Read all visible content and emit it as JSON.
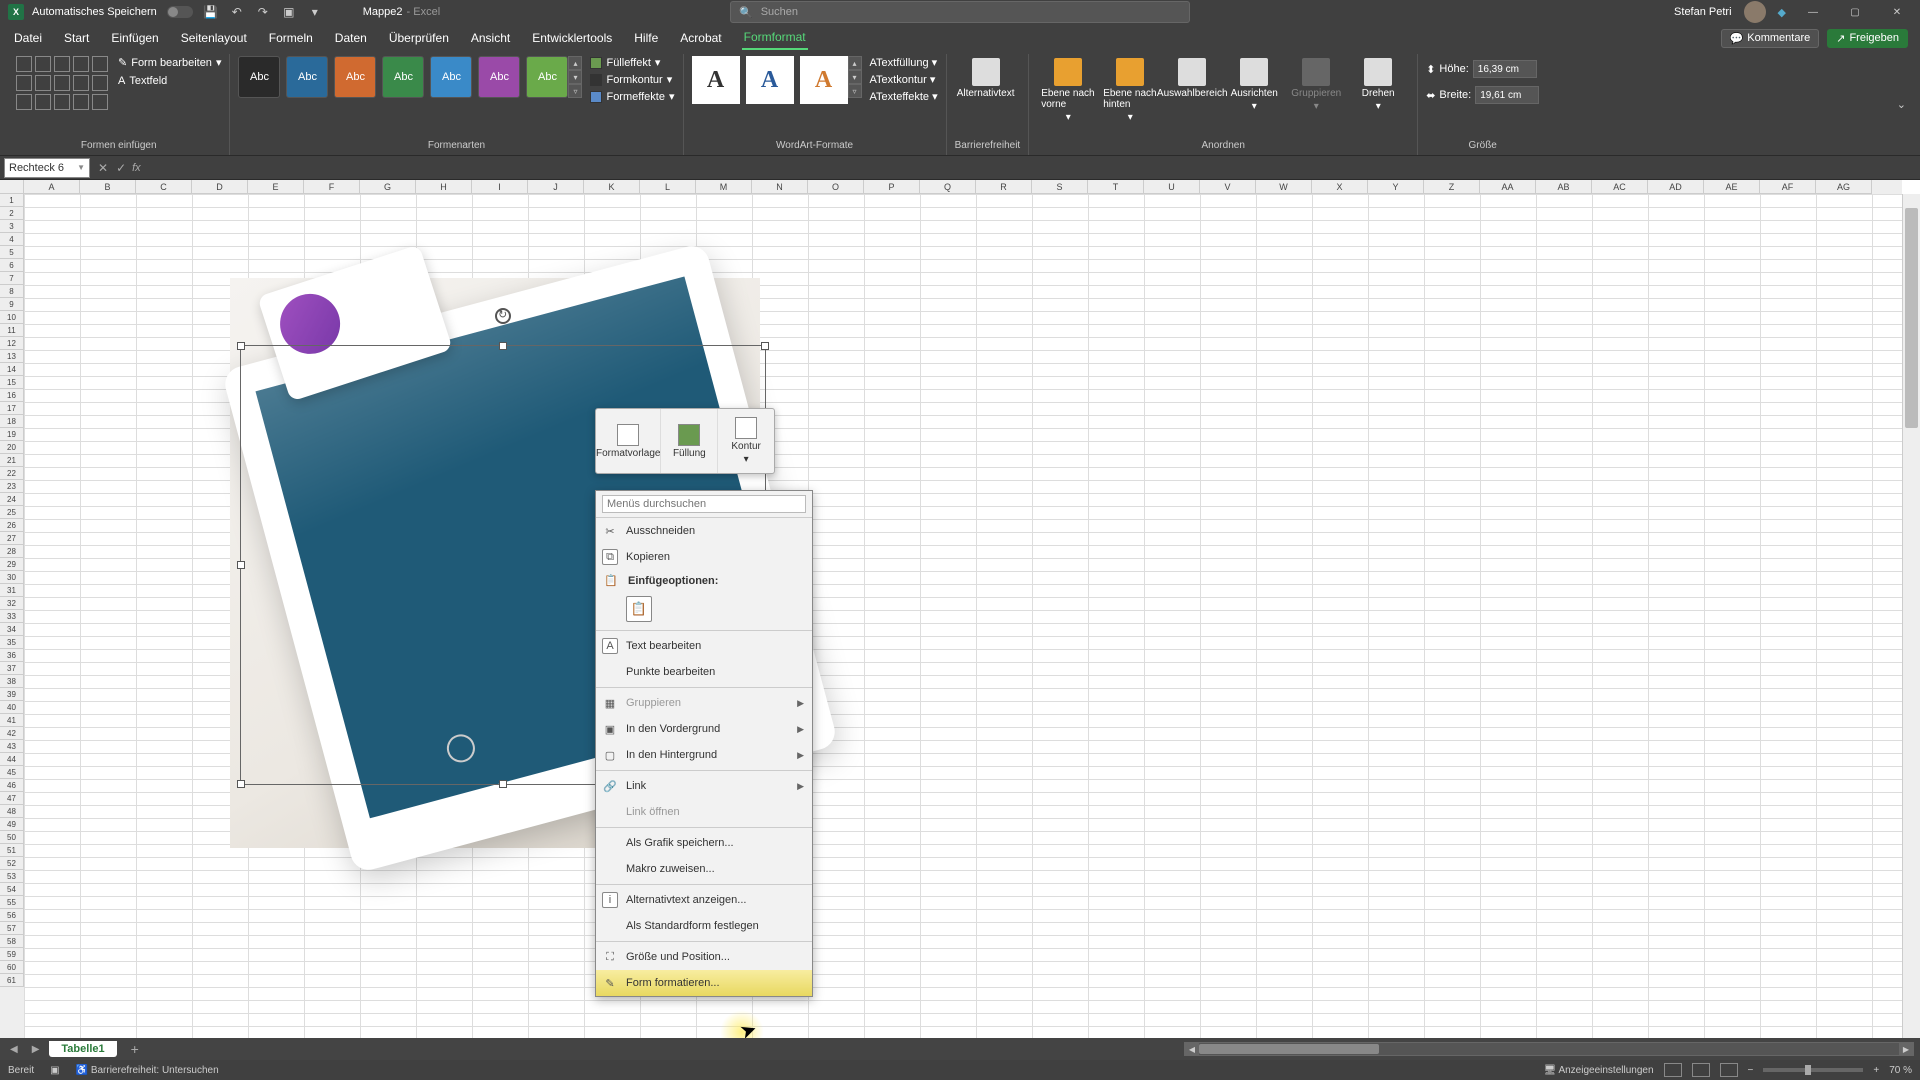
{
  "titlebar": {
    "autosave_label": "Automatisches Speichern",
    "doc_name": "Mappe2",
    "app_name": "Excel",
    "search_placeholder": "Suchen",
    "user_name": "Stefan Petri"
  },
  "tabs": {
    "file": "Datei",
    "home": "Start",
    "insert": "Einfügen",
    "page_layout": "Seitenlayout",
    "formulas": "Formeln",
    "data": "Daten",
    "review": "Überprüfen",
    "view": "Ansicht",
    "developer": "Entwicklertools",
    "help": "Hilfe",
    "acrobat": "Acrobat",
    "shape_format": "Formformat",
    "comments": "Kommentare",
    "share": "Freigeben"
  },
  "ribbon": {
    "insert_shapes_group": "Formen einfügen",
    "edit_shape": "Form bearbeiten",
    "text_box": "Textfeld",
    "shape_styles_group": "Formenarten",
    "style_label": "Abc",
    "fill": "Fülleffekt",
    "outline": "Formkontur",
    "effects": "Formeffekte",
    "wordart_group": "WordArt-Formate",
    "text_fill": "Textfüllung",
    "text_outline": "Textkontur",
    "text_effects": "Texteffekte",
    "accessibility_group": "Barrierefreiheit",
    "alt_text": "Alternativtext",
    "arrange_group": "Anordnen",
    "bring_forward": "Ebene nach vorne",
    "send_backward": "Ebene nach hinten",
    "selection_pane": "Auswahlbereich",
    "align": "Ausrichten",
    "group": "Gruppieren",
    "rotate": "Drehen",
    "size_group": "Größe",
    "height_label": "Höhe:",
    "width_label": "Breite:",
    "height_value": "16,39 cm",
    "width_value": "19,61 cm"
  },
  "style_colors": [
    "#2a2a2a",
    "#2a6a9a",
    "#d06a30",
    "#3a8a4a",
    "#3a8ac8",
    "#9a4aa8",
    "#6aaa4a"
  ],
  "wordart_colors": [
    "#333333",
    "#2a5a9a",
    "#d07a30"
  ],
  "formula_bar": {
    "name_box": "Rechteck 6"
  },
  "columns": [
    "A",
    "B",
    "C",
    "D",
    "E",
    "F",
    "G",
    "H",
    "I",
    "J",
    "K",
    "L",
    "M",
    "N",
    "O",
    "P",
    "Q",
    "R",
    "S",
    "T",
    "U",
    "V",
    "W",
    "X",
    "Y",
    "Z",
    "AA",
    "AB",
    "AC",
    "AD",
    "AE",
    "AF",
    "AG"
  ],
  "mini_toolbar": {
    "style": "Formatvorlage",
    "fill": "Füllung",
    "outline": "Kontur"
  },
  "context_menu": {
    "search_placeholder": "Menüs durchsuchen",
    "cut": "Ausschneiden",
    "copy": "Kopieren",
    "paste_options": "Einfügeoptionen:",
    "edit_text": "Text bearbeiten",
    "edit_points": "Punkte bearbeiten",
    "group": "Gruppieren",
    "bring_front": "In den Vordergrund",
    "send_back": "In den Hintergrund",
    "link": "Link",
    "open_link": "Link öffnen",
    "save_graphic": "Als Grafik speichern...",
    "assign_macro": "Makro zuweisen...",
    "show_alt_text": "Alternativtext anzeigen...",
    "set_default": "Als Standardform festlegen",
    "size_position": "Größe und Position...",
    "format_shape": "Form formatieren..."
  },
  "sheet_tabs": {
    "sheet1": "Tabelle1"
  },
  "status_bar": {
    "ready": "Bereit",
    "accessibility": "Barrierefreiheit: Untersuchen",
    "display_settings": "Anzeigeeinstellungen",
    "zoom": "70 %"
  }
}
